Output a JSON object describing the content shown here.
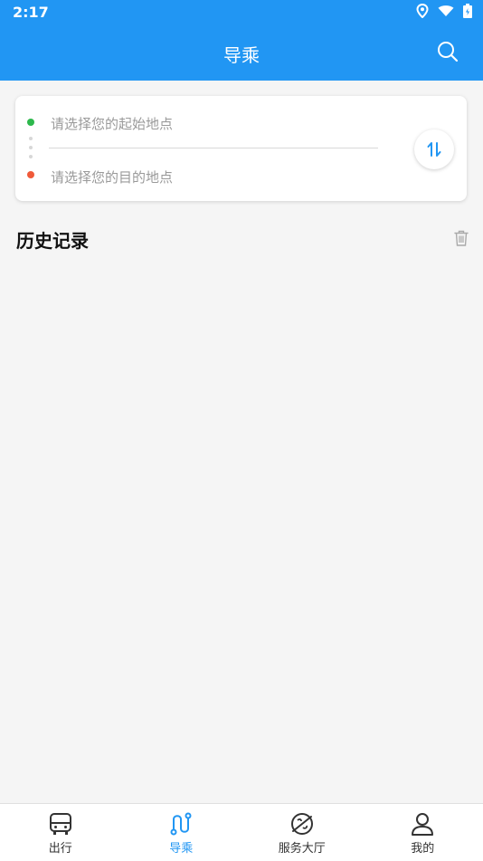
{
  "status": {
    "time": "2:17",
    "icons": [
      "location-icon",
      "wifi-icon",
      "battery-icon"
    ]
  },
  "header": {
    "title": "导乘",
    "search_icon": "search-icon"
  },
  "route": {
    "start_placeholder": "请选择您的起始地点",
    "end_placeholder": "请选择您的目的地点",
    "start_color": "#2db84c",
    "end_color": "#f05a3a",
    "swap_icon": "swap-icon"
  },
  "history": {
    "title": "历史记录",
    "clear_icon": "trash-icon"
  },
  "nav": {
    "items": [
      {
        "label": "出行",
        "icon": "bus-icon",
        "active": false
      },
      {
        "label": "导乘",
        "icon": "route-icon",
        "active": true
      },
      {
        "label": "服务大厅",
        "icon": "planet-icon",
        "active": false
      },
      {
        "label": "我的",
        "icon": "user-icon",
        "active": false
      }
    ]
  },
  "colors": {
    "primary": "#2196F3",
    "background": "#f5f5f5"
  }
}
